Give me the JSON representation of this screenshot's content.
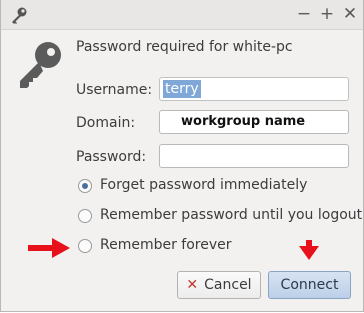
{
  "window": {
    "title_icon": "key-icon",
    "controls": [
      "minimize",
      "maximize",
      "close"
    ],
    "control_glyphs": {
      "minimize": "−",
      "maximize": "+",
      "close": "✕"
    }
  },
  "dialog": {
    "heading": "Password required for white-pc",
    "username_label": "Username:",
    "username_value": "terry",
    "domain_label": "Domain:",
    "domain_value": "workgroup name",
    "password_label": "Password:",
    "password_value": ""
  },
  "options": [
    {
      "label": "Forget password immediately",
      "checked": true
    },
    {
      "label": "Remember password until you logout",
      "checked": false
    },
    {
      "label": "Remember forever",
      "checked": false
    }
  ],
  "buttons": {
    "cancel_icon": "✕",
    "cancel_label": "Cancel",
    "connect_label": "Connect"
  },
  "colors": {
    "annotation_red": "#e8101a",
    "selection": "#7fa8d9",
    "radio_dot": "#4a6f9c"
  }
}
